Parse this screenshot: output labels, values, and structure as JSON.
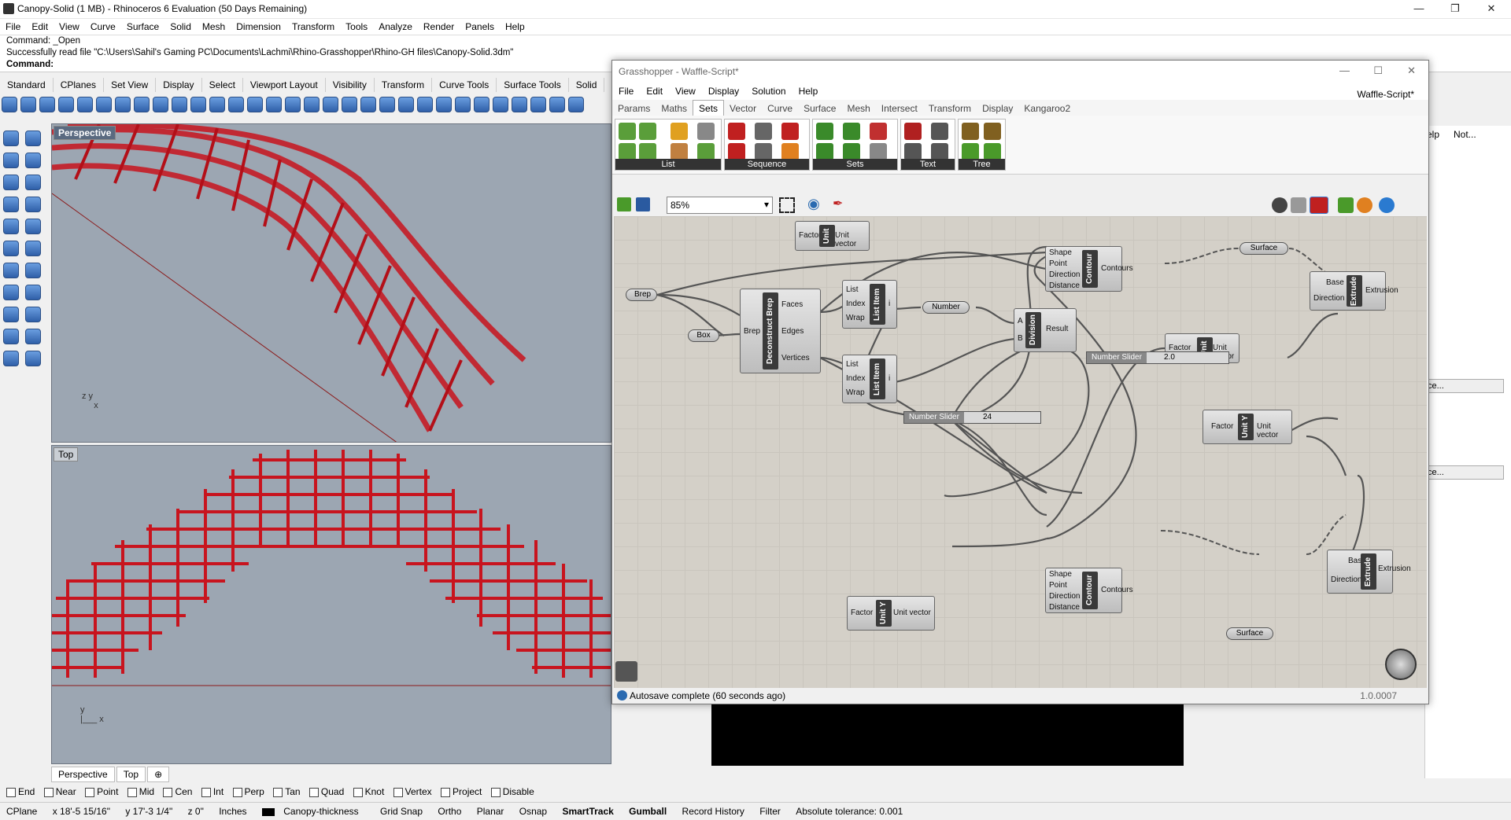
{
  "app": {
    "title": "Canopy-Solid (1 MB) - Rhinoceros 6 Evaluation (50 Days Remaining)"
  },
  "menu": [
    "File",
    "Edit",
    "View",
    "Curve",
    "Surface",
    "Solid",
    "Mesh",
    "Dimension",
    "Transform",
    "Tools",
    "Analyze",
    "Render",
    "Panels",
    "Help"
  ],
  "command": {
    "line1": "Command: _Open",
    "line2": "Successfully read file \"C:\\Users\\Sahil's Gaming PC\\Documents\\Lachmi\\Rhino-Grasshopper\\Rhino-GH files\\Canopy-Solid.3dm\"",
    "prompt": "Command:"
  },
  "toolbar_tabs": [
    "Standard",
    "CPlanes",
    "Set View",
    "Display",
    "Select",
    "Viewport Layout",
    "Visibility",
    "Transform",
    "Curve Tools",
    "Surface Tools",
    "Solid"
  ],
  "viewports": {
    "perspective": "Perspective",
    "top": "Top"
  },
  "viewport_tabs": [
    "Perspective",
    "Top"
  ],
  "osnap": [
    "End",
    "Near",
    "Point",
    "Mid",
    "Cen",
    "Int",
    "Perp",
    "Tan",
    "Quad",
    "Knot",
    "Vertex",
    "Project",
    "Disable"
  ],
  "status": {
    "cplane": "CPlane",
    "x": "x 18'-5 15/16\"",
    "y": "y 17'-3 1/4\"",
    "z": "z 0\"",
    "units": "Inches",
    "layer": "Canopy-thickness",
    "items": [
      "Grid Snap",
      "Ortho",
      "Planar",
      "Osnap",
      "SmartTrack",
      "Gumball",
      "Record History",
      "Filter"
    ],
    "tolerance": "Absolute tolerance: 0.001"
  },
  "right_panel": {
    "tab1": "elp",
    "tab2": "Not...",
    "btn": "ce..."
  },
  "grasshopper": {
    "title": "Grasshopper - Waffle-Script*",
    "document": "Waffle-Script*",
    "menu": [
      "File",
      "Edit",
      "View",
      "Display",
      "Solution",
      "Help"
    ],
    "tabs": [
      "Params",
      "Maths",
      "Sets",
      "Vector",
      "Curve",
      "Surface",
      "Mesh",
      "Intersect",
      "Transform",
      "Display",
      "Kangaroo2"
    ],
    "selected_tab": "Sets",
    "groups": [
      "List",
      "Sequence",
      "Sets",
      "Text",
      "Tree"
    ],
    "zoom": "85%",
    "status": "Autosave complete (60 seconds ago)",
    "version": "1.0.0007",
    "components": {
      "unitx1": {
        "core": "Unit X",
        "in": [
          "Factor"
        ],
        "out": [
          "Unit vector"
        ]
      },
      "contour1": {
        "core": "Contour",
        "in": [
          "Shape",
          "Point",
          "Direction",
          "Distance"
        ],
        "out": [
          "Contours"
        ]
      },
      "surface1": "Surface",
      "extrude1": {
        "core": "Extrude",
        "in": [
          "Base",
          "Direction"
        ],
        "out": [
          "Extrusion"
        ]
      },
      "unitx2": {
        "core": "Unit X",
        "in": [
          "Factor"
        ],
        "out": [
          "Unit vector"
        ]
      },
      "brep": "Brep",
      "box": "Box",
      "deconstruct": {
        "core": "Deconstruct Brep",
        "in": [
          "Brep"
        ],
        "out": [
          "Faces",
          "Edges",
          "Vertices"
        ]
      },
      "listitem1": {
        "core": "List Item",
        "in": [
          "List",
          "Index",
          "Wrap"
        ],
        "out": [
          "i"
        ]
      },
      "number": "Number",
      "division": {
        "core": "Division",
        "in": [
          "A",
          "B"
        ],
        "out": [
          "Result"
        ]
      },
      "slider1": {
        "label": "Number Slider",
        "value": "2.0"
      },
      "listitem2": {
        "core": "List Item",
        "in": [
          "List",
          "Index",
          "Wrap"
        ],
        "out": [
          "i"
        ]
      },
      "slider2": {
        "label": "Number Slider",
        "value": "24"
      },
      "unity1": {
        "core": "Unit Y",
        "in": [
          "Factor"
        ],
        "out": [
          "Unit vector"
        ]
      },
      "extrude2": {
        "core": "Extrude",
        "in": [
          "Base",
          "Direction"
        ],
        "out": [
          "Extrusion"
        ]
      },
      "contour2": {
        "core": "Contour",
        "in": [
          "Shape",
          "Point",
          "Direction",
          "Distance"
        ],
        "out": [
          "Contours"
        ]
      },
      "unity2": {
        "core": "Unit Y",
        "in": [
          "Factor"
        ],
        "out": [
          "Unit vector"
        ]
      },
      "surface2": "Surface"
    }
  },
  "colors": {
    "waffle": "#c8141e",
    "canvas": "#d4d0c8"
  }
}
